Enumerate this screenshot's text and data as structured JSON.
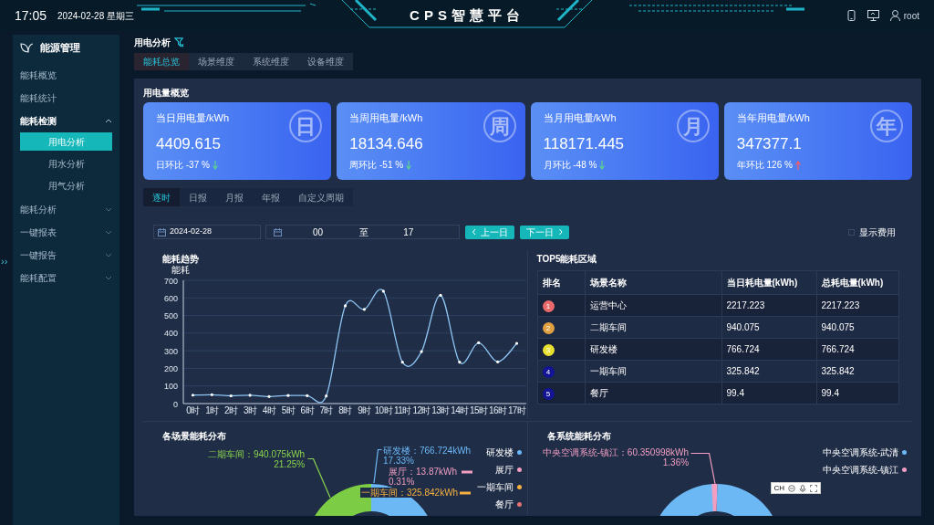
{
  "header": {
    "time": "17:05",
    "date": "2024-02-28 星期三",
    "title": "CPS智慧平台",
    "user": "root"
  },
  "sidebar_toggle": "››",
  "sidebar": {
    "title": "能源管理",
    "items": [
      {
        "label": "能耗概览"
      },
      {
        "label": "能耗统计"
      },
      {
        "label": "能耗检测",
        "expanded": true,
        "children": [
          {
            "label": "用电分析",
            "selected": true
          },
          {
            "label": "用水分析",
            "selected": false
          },
          {
            "label": "用气分析",
            "selected": false
          }
        ]
      },
      {
        "label": "能耗分析",
        "expanded": false
      },
      {
        "label": "一键报表",
        "expanded": false
      },
      {
        "label": "一键报告",
        "expanded": false
      },
      {
        "label": "能耗配置",
        "expanded": false
      }
    ]
  },
  "page_title": "用电分析",
  "tabs": [
    {
      "label": "能耗总览",
      "selected": true
    },
    {
      "label": "场景维度",
      "selected": false
    },
    {
      "label": "系统维度",
      "selected": false
    },
    {
      "label": "设备维度",
      "selected": false
    }
  ],
  "overview": {
    "title": "用电量概览",
    "cards": [
      {
        "label": "当日用电量/kWh",
        "value": "4409.615",
        "compare": "日环比 -37 %",
        "rising": false,
        "badge": "日"
      },
      {
        "label": "当周用电量/kWh",
        "value": "18134.646",
        "compare": "周环比 -51 %",
        "rising": false,
        "badge": "周"
      },
      {
        "label": "当月用电量/kWh",
        "value": "118171.445",
        "compare": "月环比 -48 %",
        "rising": false,
        "badge": "月"
      },
      {
        "label": "当年用电量/kWh",
        "value": "347377.1",
        "compare": "年环比 126 %",
        "rising": true,
        "badge": "年"
      }
    ]
  },
  "period_tabs": [
    {
      "label": "逐时",
      "selected": true
    },
    {
      "label": "日报",
      "selected": false
    },
    {
      "label": "月报",
      "selected": false
    },
    {
      "label": "年报",
      "selected": false
    },
    {
      "label": "自定义周期",
      "selected": false
    }
  ],
  "filters": {
    "date": "2024-02-28",
    "start_hour": "00",
    "separator": "至",
    "end_hour": "17",
    "prev_button": "上一日",
    "next_button": "下一日",
    "show_cost": {
      "label": "显示费用",
      "checked": false
    }
  },
  "trend": {
    "chart_data": {
      "type": "line",
      "title": "能耗趋势",
      "ylabel": "能耗",
      "grid": true,
      "categories": [
        "0时",
        "1时",
        "2时",
        "3时",
        "4时",
        "5时",
        "6时",
        "7时",
        "8时",
        "9时",
        "10时",
        "11时",
        "12时",
        "13时",
        "14时",
        "15时",
        "16时",
        "17时"
      ],
      "ylim": [
        0,
        700
      ],
      "yticks": [
        0,
        100,
        200,
        300,
        400,
        500,
        600,
        700
      ],
      "series": [
        {
          "color": "#8ec5f2",
          "values": [
            48,
            50,
            44,
            47,
            40,
            46,
            45,
            43,
            555,
            535,
            638,
            235,
            295,
            615,
            235,
            345,
            237,
            342
          ]
        }
      ]
    }
  },
  "top5": {
    "title": "TOP5能耗区域",
    "columns": [
      "排名",
      "场景名称",
      "当日耗电量(kWh)",
      "总耗电量(kWh)"
    ],
    "rows": [
      {
        "rank": "1",
        "color": "#e86a6a",
        "name": "运营中心",
        "today": "2217.223",
        "total": "2217.223"
      },
      {
        "rank": "2",
        "color": "#e0a040",
        "name": "二期车间",
        "today": "940.075",
        "total": "940.075"
      },
      {
        "rank": "3",
        "color": "#e8e030",
        "name": "研发楼",
        "today": "766.724",
        "total": "766.724"
      },
      {
        "rank": "4",
        "color": "#141496",
        "name": "一期车间",
        "today": "325.842",
        "total": "325.842"
      },
      {
        "rank": "5",
        "color": "#141496",
        "name": "餐厅",
        "today": "99.4",
        "total": "99.4"
      }
    ]
  },
  "scene_distribution": {
    "title": "各场景能耗分布",
    "legend": [
      {
        "label": "研发楼",
        "color": "#6cb8f5"
      },
      {
        "label": "展厅",
        "color": "#f19ec2"
      },
      {
        "label": "一期车间",
        "color": "#f5b041"
      },
      {
        "label": "餐厅",
        "color": "#e57373"
      }
    ],
    "callouts": [
      {
        "label": "二期车间：940.075kWh",
        "percent": "21.25%",
        "color": "#8bd34c"
      },
      {
        "label": "研发楼：766.724kWh",
        "percent": "17.33%",
        "color": "#6cb8f5"
      },
      {
        "label": "展厅：13.87kWh",
        "percent": "0.31%",
        "color": "#f19ec2"
      },
      {
        "label": "一期车间：325.842kWh",
        "color": "#f5b041"
      }
    ]
  },
  "system_distribution": {
    "title": "各系统能耗分布",
    "legend": [
      {
        "label": "中央空调系统-武清",
        "color": "#6cb8f5"
      },
      {
        "label": "中央空调系统-镇江",
        "color": "#f19ec2"
      }
    ],
    "callouts": [
      {
        "label": "中央空调系统-镇江：60.350998kWh",
        "percent": "1.36%",
        "color": "#f19ec2"
      }
    ]
  },
  "ime_toolbar": {
    "label": "CH"
  }
}
